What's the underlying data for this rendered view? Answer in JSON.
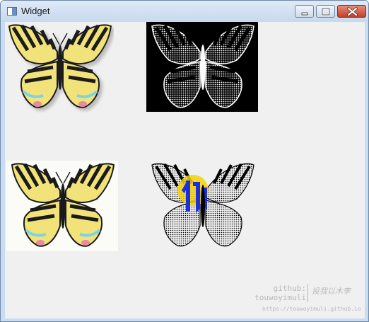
{
  "window": {
    "title": "Widget",
    "app_icon": "qt-window-icon",
    "controls": {
      "minimize_icon": "minimize-icon",
      "maximize_icon": "maximize-icon",
      "close_icon": "close-icon"
    }
  },
  "images": [
    {
      "label": "original-butterfly",
      "style": "color",
      "colors": [
        "#f2e27a",
        "#1a1a1a",
        "#7fd3e0",
        "#e88aa0"
      ]
    },
    {
      "label": "inverted-mono-butterfly",
      "style": "inverted-monochrome",
      "colors": [
        "#000000",
        "#ffffff"
      ]
    },
    {
      "label": "light-background-butterfly",
      "style": "color-light-bg",
      "colors": [
        "#f2e27a",
        "#1a1a1a",
        "#7fd3e0",
        "#e88aa0"
      ]
    },
    {
      "label": "dithered-butterfly",
      "style": "dithered-mono-with-logo",
      "colors": [
        "#000000",
        "#f5d20a",
        "#1c2fe0"
      ]
    }
  ],
  "watermark": {
    "line1": "github:",
    "line2": "touwoyimuli",
    "right_text": "投我以木李",
    "url": "https://touwoyimuli.github.io"
  }
}
